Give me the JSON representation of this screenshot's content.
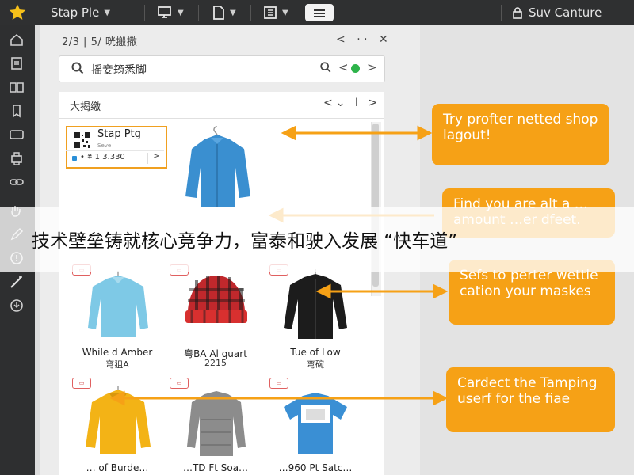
{
  "toolbar": {
    "doc_name": "Stap Ple",
    "user_name": "Suv Canture",
    "colors": {
      "bar": "#2f3031",
      "star": "#f7c11a"
    }
  },
  "panel": {
    "pager": "2/3 | 5/ 咣搬撒",
    "search_placeholder": "摇妾筠悉脚",
    "content_title": "大揭缴"
  },
  "featured_product": {
    "name": "Stap Ptg",
    "sub": "Seve",
    "price": "• ¥ 1 3.330"
  },
  "grid": {
    "items": [
      {
        "title": "While d Amber",
        "sub": "弯狙A"
      },
      {
        "title": "粤BA Al quart",
        "sub": "2215"
      },
      {
        "title": "Tue of Low",
        "sub": "弯碗"
      },
      {
        "title": "…  of Burde…",
        "sub": ""
      },
      {
        "title": "…TD Ft Soa…",
        "sub": ""
      },
      {
        "title": "…960 Pt Satc…",
        "sub": ""
      }
    ]
  },
  "callouts": [
    {
      "text": "Try profter netted shop lagout!"
    },
    {
      "text": "Find you are alt a …amount …er dfeet."
    },
    {
      "text": "Sefs to perter wettle cation your maskes"
    },
    {
      "text": "Cardect the Tamping userf for the fiae"
    }
  ],
  "banner": {
    "text": "技术壁垒铸就核心竞争力，富泰和驶入发展 “快车道”"
  },
  "accent_color": "#f6a116"
}
